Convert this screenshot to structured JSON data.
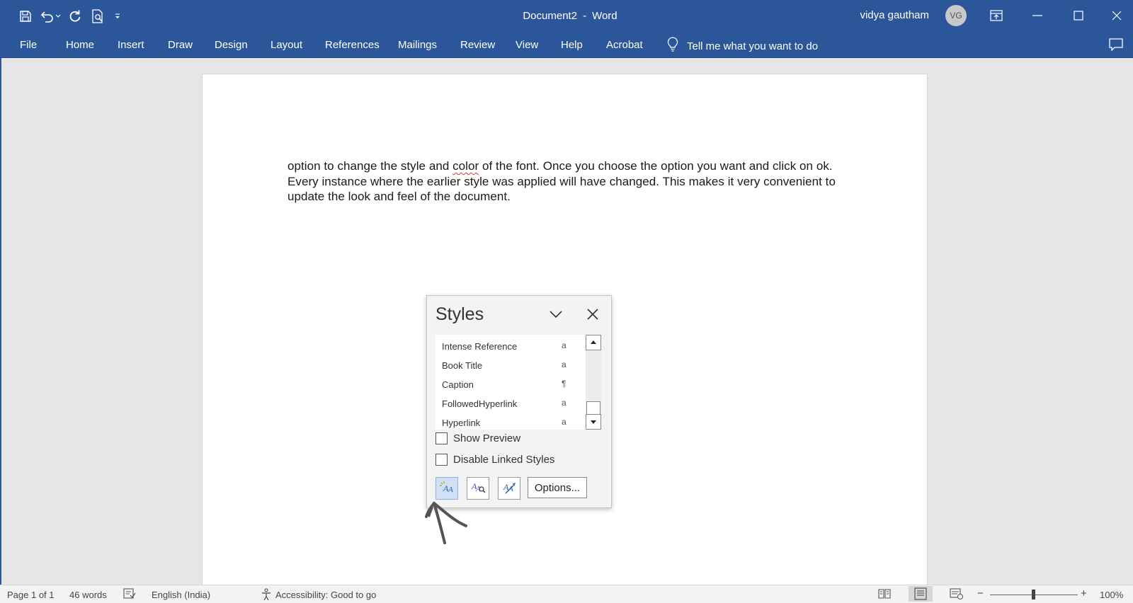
{
  "titlebar": {
    "document_name": "Document2",
    "separator": "-",
    "app_name": "Word",
    "user_name": "vidya gautham",
    "user_initials": "VG"
  },
  "qat_icons": [
    "save-icon",
    "undo-icon",
    "redo-icon",
    "print-preview-icon",
    "customize-qat-icon"
  ],
  "ribbon": {
    "tabs": [
      "File",
      "Home",
      "Insert",
      "Draw",
      "Design",
      "Layout",
      "References",
      "Mailings",
      "Review",
      "View",
      "Help",
      "Acrobat"
    ],
    "tell_me": "Tell me what you want to do"
  },
  "document": {
    "before_misspelled": "option to change the style and ",
    "misspelled_word": "color",
    "after_misspelled": " of the font. Once you choose the option you want and click on ok. Every instance where the earlier style was applied will have changed. This makes it very convenient to update the look and feel of the document."
  },
  "styles_pane": {
    "title": "Styles",
    "items": [
      {
        "name": "Intense Reference",
        "marker": "a"
      },
      {
        "name": "Book Title",
        "marker": "a"
      },
      {
        "name": "Caption",
        "marker": "¶"
      },
      {
        "name": "FollowedHyperlink",
        "marker": "a"
      },
      {
        "name": "Hyperlink",
        "marker": "a"
      }
    ],
    "show_preview_label": "Show Preview",
    "show_preview_checked": false,
    "disable_linked_label": "Disable Linked Styles",
    "disable_linked_checked": false,
    "options_label": "Options...",
    "buttons": [
      "new-style-icon",
      "style-inspector-icon",
      "manage-styles-icon"
    ]
  },
  "statusbar": {
    "page": "Page 1 of 1",
    "words": "46 words",
    "language": "English (India)",
    "accessibility": "Accessibility: Good to go",
    "zoom": "100%",
    "zoom_minus": "−",
    "zoom_plus": "+"
  },
  "colors": {
    "ribbon": "#2b579a",
    "canvas": "#e6e6e6",
    "active_button": "#cfe0f7"
  }
}
